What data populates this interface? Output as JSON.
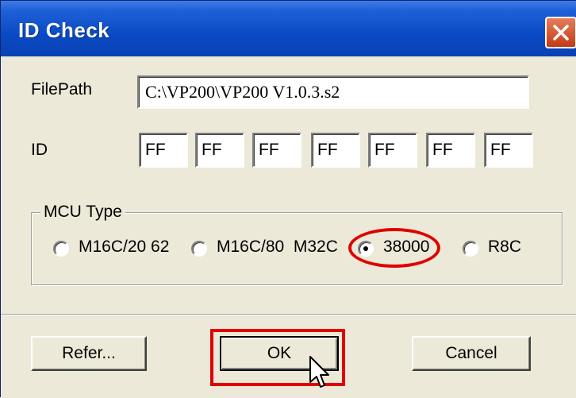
{
  "window": {
    "title": "ID Check",
    "title_bar_color": "#0a4ac4",
    "close_button_color": "#c33a14"
  },
  "filepath": {
    "label": "FilePath",
    "value": "C:\\VP200\\VP200 V1.0.3.s2"
  },
  "id": {
    "label": "ID",
    "values": [
      "FF",
      "FF",
      "FF",
      "FF",
      "FF",
      "FF",
      "FF"
    ]
  },
  "mcu_type": {
    "group_label": "MCU Type",
    "options": [
      {
        "label": "M16C/20 62",
        "selected": false
      },
      {
        "label": "M16C/80  M32C",
        "selected": false
      },
      {
        "label": "38000",
        "selected": true
      },
      {
        "label": "R8C",
        "selected": false
      }
    ]
  },
  "buttons": {
    "refer": "Refer...",
    "ok": "OK",
    "cancel": "Cancel"
  },
  "annotations": {
    "highlight_color": "#e00000"
  },
  "icons": [
    "close-icon",
    "mouse-pointer-icon"
  ]
}
